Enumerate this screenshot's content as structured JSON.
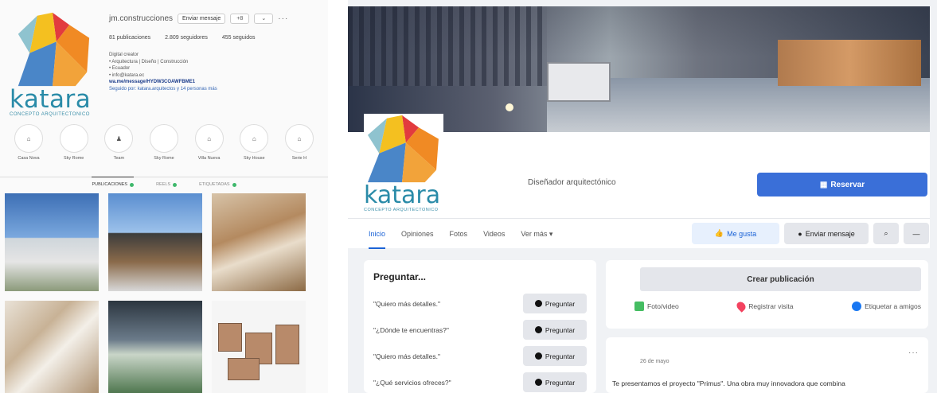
{
  "instagram": {
    "brand": "katara",
    "tagline": "CONCEPTO ARQUITECTONICO",
    "username": "jm.construcciones",
    "buttons": {
      "message": "Enviar mensaje",
      "follow": "+8",
      "more": "···"
    },
    "stats": [
      "81 publicaciones",
      "2.809 seguidores",
      "455 seguidos"
    ],
    "bio": [
      "Digital creator",
      "• Arquitectura | Diseño | Construcción",
      "• Ecuador",
      "• info@katara.ec",
      "wa.me/message/HYDW3COAWFBME1",
      "Seguido por: katara.arquitectos y 14 personas más"
    ],
    "highlights": [
      {
        "label": "Casa Nova",
        "icon": "house-icon"
      },
      {
        "label": "Sky Rome",
        "icon": ""
      },
      {
        "label": "Team",
        "icon": "people-icon"
      },
      {
        "label": "Sky Rome",
        "icon": ""
      },
      {
        "label": "Villa Nueva",
        "icon": "house-icon"
      },
      {
        "label": "Sky House",
        "icon": "house-icon"
      },
      {
        "label": "Serie H",
        "icon": "house-icon"
      }
    ],
    "tabs": [
      "PUBLICACIONES",
      "REELS",
      "ETIQUETADAS"
    ]
  },
  "facebook": {
    "brand": "katara",
    "tagline": "CONCEPTO ARQUITECTONICO",
    "category": "Diseñador arquitectónico",
    "reserve_label": "Reservar",
    "tabs": [
      "Inicio",
      "Opiniones",
      "Fotos",
      "Videos",
      "Ver más ▾"
    ],
    "actions": {
      "like": "Me gusta",
      "message": "Enviar mensaje"
    },
    "ask": {
      "title": "Preguntar...",
      "questions": [
        "\"Quiero más detalles.\"",
        "\"¿Dónde te encuentras?\"",
        "\"Quiero más detalles.\"",
        "\"¿Qué servicios ofreces?\""
      ],
      "button_label": "Preguntar"
    },
    "create": {
      "label": "Crear publicación",
      "options": [
        "Foto/video",
        "Registrar visita",
        "Etiquetar a amigos"
      ]
    },
    "post": {
      "date": "26 de mayo",
      "text": "Te presentamos el proyecto \"Primus\". Una obra muy innovadora que combina"
    }
  },
  "colors": {
    "brand_teal": "#2a8ba8",
    "fb_blue": "#3a6fd8",
    "logo_red": "#e23b3e",
    "logo_yellow": "#f4c020",
    "logo_orange": "#f08a24",
    "logo_blue": "#4a86c8"
  }
}
